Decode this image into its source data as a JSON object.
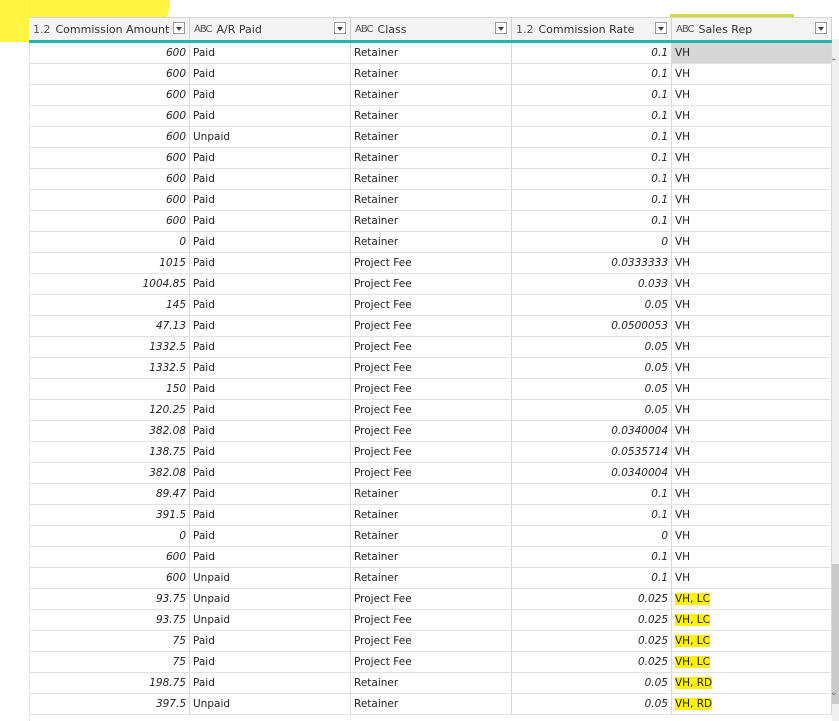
{
  "columns": [
    {
      "type": "1.2",
      "label": "Commission Amount",
      "align": "right"
    },
    {
      "type": "ABC",
      "label": "A/R Paid",
      "align": "left"
    },
    {
      "type": "ABC",
      "label": "Class",
      "align": "left"
    },
    {
      "type": "1.2",
      "label": "Commission Rate",
      "align": "right"
    },
    {
      "type": "ABC",
      "label": "Sales Rep",
      "align": "left"
    }
  ],
  "rows": [
    [
      "600",
      "Paid",
      "Retainer",
      "0.1",
      "VH"
    ],
    [
      "600",
      "Paid",
      "Retainer",
      "0.1",
      "VH"
    ],
    [
      "600",
      "Paid",
      "Retainer",
      "0.1",
      "VH"
    ],
    [
      "600",
      "Paid",
      "Retainer",
      "0.1",
      "VH"
    ],
    [
      "600",
      "Unpaid",
      "Retainer",
      "0.1",
      "VH"
    ],
    [
      "600",
      "Paid",
      "Retainer",
      "0.1",
      "VH"
    ],
    [
      "600",
      "Paid",
      "Retainer",
      "0.1",
      "VH"
    ],
    [
      "600",
      "Paid",
      "Retainer",
      "0.1",
      "VH"
    ],
    [
      "600",
      "Paid",
      "Retainer",
      "0.1",
      "VH"
    ],
    [
      "0",
      "Paid",
      "Retainer",
      "0",
      "VH"
    ],
    [
      "1015",
      "Paid",
      "Project Fee",
      "0.0333333",
      "VH"
    ],
    [
      "1004.85",
      "Paid",
      "Project Fee",
      "0.033",
      "VH"
    ],
    [
      "145",
      "Paid",
      "Project Fee",
      "0.05",
      "VH"
    ],
    [
      "47.13",
      "Paid",
      "Project Fee",
      "0.0500053",
      "VH"
    ],
    [
      "1332.5",
      "Paid",
      "Project Fee",
      "0.05",
      "VH"
    ],
    [
      "1332.5",
      "Paid",
      "Project Fee",
      "0.05",
      "VH"
    ],
    [
      "150",
      "Paid",
      "Project Fee",
      "0.05",
      "VH"
    ],
    [
      "120.25",
      "Paid",
      "Project Fee",
      "0.05",
      "VH"
    ],
    [
      "382.08",
      "Paid",
      "Project Fee",
      "0.0340004",
      "VH"
    ],
    [
      "138.75",
      "Paid",
      "Project Fee",
      "0.0535714",
      "VH"
    ],
    [
      "382.08",
      "Paid",
      "Project Fee",
      "0.0340004",
      "VH"
    ],
    [
      "89.47",
      "Paid",
      "Retainer",
      "0.1",
      "VH"
    ],
    [
      "391.5",
      "Paid",
      "Retainer",
      "0.1",
      "VH"
    ],
    [
      "0",
      "Paid",
      "Retainer",
      "0",
      "VH"
    ],
    [
      "600",
      "Paid",
      "Retainer",
      "0.1",
      "VH"
    ],
    [
      "600",
      "Unpaid",
      "Retainer",
      "0.1",
      "VH"
    ],
    [
      "93.75",
      "Unpaid",
      "Project Fee",
      "0.025",
      "VH, LC"
    ],
    [
      "93.75",
      "Unpaid",
      "Project Fee",
      "0.025",
      "VH, LC"
    ],
    [
      "75",
      "Paid",
      "Project Fee",
      "0.025",
      "VH, LC"
    ],
    [
      "75",
      "Paid",
      "Project Fee",
      "0.025",
      "VH, LC"
    ],
    [
      "198.75",
      "Paid",
      "Retainer",
      "0.05",
      "VH, RD"
    ],
    [
      "397.5",
      "Unpaid",
      "Retainer",
      "0.05",
      "VH, RD"
    ]
  ],
  "highlights": {
    "color": "#fff200",
    "sales_rep_rows": [
      26,
      27,
      28,
      29,
      30,
      31
    ]
  },
  "accent_color": "#20b6b0"
}
